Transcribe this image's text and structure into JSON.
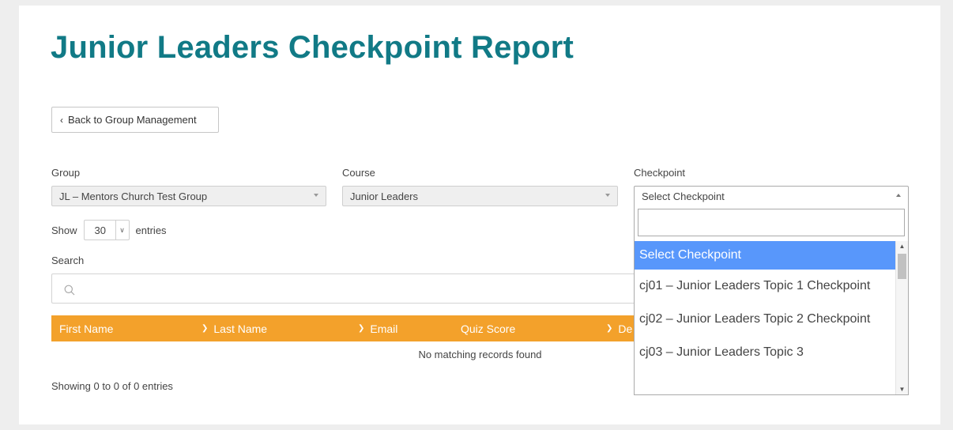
{
  "page": {
    "title": "Junior Leaders Checkpoint Report"
  },
  "back_button": {
    "label": "Back to Group Management"
  },
  "filters": {
    "group": {
      "label": "Group",
      "value": "JL – Mentors Church Test Group"
    },
    "course": {
      "label": "Course",
      "value": "Junior Leaders"
    },
    "checkpoint": {
      "label": "Checkpoint",
      "value": "Select Checkpoint"
    }
  },
  "length": {
    "show": "Show",
    "value": "30",
    "entries": "entries"
  },
  "search": {
    "label": "Search",
    "placeholder": ""
  },
  "table": {
    "headers": [
      "First Name",
      "Last Name",
      "Email",
      "Quiz Score",
      "De"
    ],
    "empty_message": "No matching records found",
    "info": "Showing 0 to 0 of 0 entries"
  },
  "checkpoint_dropdown": {
    "search_value": "",
    "options": [
      {
        "label": "Select Checkpoint",
        "highlighted": true
      },
      {
        "label": "cj01 – Junior Leaders Topic 1 Checkpoint"
      },
      {
        "label": "cj02 – Junior Leaders Topic 2 Checkpoint"
      },
      {
        "label": "cj03 – Junior Leaders Topic 3"
      }
    ]
  },
  "colors": {
    "title": "#117a86",
    "table_header": "#f3a12b",
    "highlight": "#5897fb"
  }
}
